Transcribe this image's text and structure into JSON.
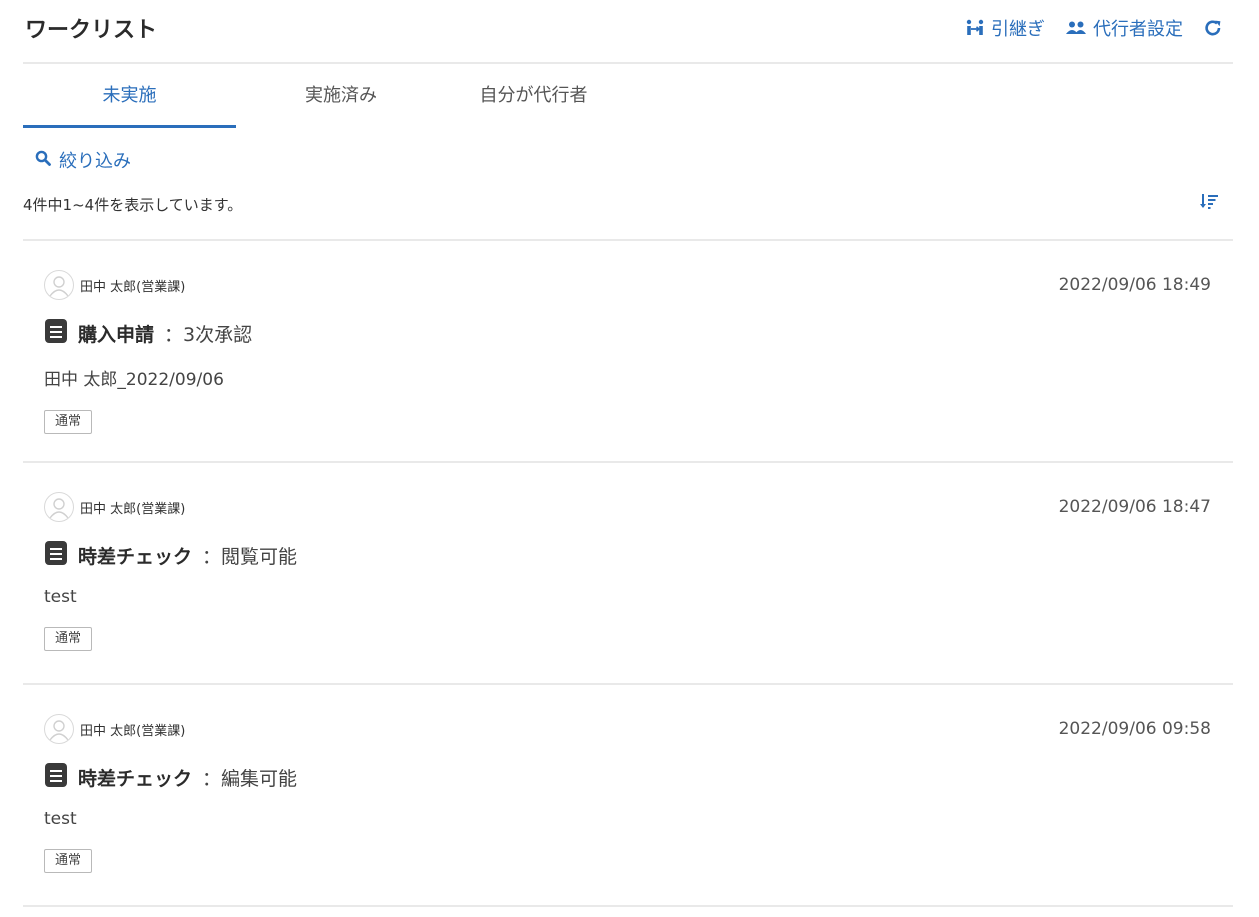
{
  "header": {
    "title": "ワークリスト",
    "handover_label": "引継ぎ",
    "proxy_label": "代行者設定"
  },
  "tabs": [
    {
      "label": "未実施",
      "active": true
    },
    {
      "label": "実施済み",
      "active": false
    },
    {
      "label": "自分が代行者",
      "active": false
    }
  ],
  "filter": {
    "label": "絞り込み"
  },
  "summary": {
    "text": "4件中1~4件を表示しています。"
  },
  "items": [
    {
      "user": "田中 太郎(営業課)",
      "datetime": "2022/09/06 18:49",
      "doc_name": "購入申請",
      "status": "：3次承認",
      "subtitle": "田中 太郎_2022/09/06",
      "tag": "通常"
    },
    {
      "user": "田中 太郎(営業課)",
      "datetime": "2022/09/06 18:47",
      "doc_name": "時差チェック",
      "status": "：閲覧可能",
      "subtitle": "test",
      "tag": "通常"
    },
    {
      "user": "田中 太郎(営業課)",
      "datetime": "2022/09/06 09:58",
      "doc_name": "時差チェック",
      "status": "：編集可能",
      "subtitle": "test",
      "tag": "通常"
    }
  ],
  "colors": {
    "accent": "#2a6ebb",
    "divider": "#e9e9e9",
    "text": "#333333"
  },
  "icons": {
    "handover": "handover-icon",
    "proxy": "users-icon",
    "refresh": "refresh-icon",
    "filter": "search-icon",
    "sort": "sort-icon",
    "avatar": "user-avatar-icon",
    "document": "document-icon"
  }
}
